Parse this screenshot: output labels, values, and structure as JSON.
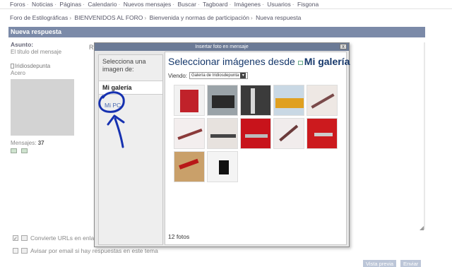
{
  "top_nav": [
    "Foros",
    "Noticias",
    "Páginas",
    "Calendario",
    "Nuevos mensajes",
    "Buscar",
    "Tagboard",
    "Imágenes",
    "Usuarios",
    "Fisgona"
  ],
  "breadcrumbs": [
    "Foro de Estilográficas",
    "BIENVENIDOS AL FORO",
    "Bienvenida y normas de participación",
    "Nueva respuesta"
  ],
  "section_title": "Nueva respuesta",
  "left": {
    "asunto_label": "Asunto:",
    "asunto_hint": "El título del mensaje",
    "username": "Iridiosdepunta",
    "rank": "Acero",
    "messages_label": "Mensajes:",
    "messages_count": "37"
  },
  "editor_partial_letter": "R",
  "options": {
    "convert_urls": "Convierte URLs en enlace",
    "email_notify": "Avisar por email si hay respuestas en este tema"
  },
  "buttons": {
    "preview": "Vista previa",
    "submit": "Enviar"
  },
  "modal": {
    "title": "Insertar foto en mensaje",
    "close": "x",
    "side_label": "Selecciona una imagen de:",
    "tab_gallery": "Mi galería",
    "tab_pc": "Mi PC",
    "heading_prefix": "Seleccionar imágenes desde",
    "heading_source": "Mi galería",
    "viewing_label": "Viendo:",
    "viewing_value": "Galería de Iridiosdepunta",
    "photo_count": "12 fotos",
    "thumbnails": [
      {
        "name": "thumb-red-notebook",
        "bg": "#f2f2f2",
        "fg": "#c0222a"
      },
      {
        "name": "thumb-camera",
        "bg": "#9aa3a8",
        "fg": "#2a2a2a"
      },
      {
        "name": "thumb-pen-clips",
        "bg": "#3b3b3b",
        "fg": "#d8d8d8"
      },
      {
        "name": "thumb-train",
        "bg": "#c9d8e4",
        "fg": "#e0a020"
      },
      {
        "name": "thumb-pen-script-1",
        "bg": "#eee8e4",
        "fg": "#7a4a4a"
      },
      {
        "name": "thumb-pen-script-2",
        "bg": "#f3eeee",
        "fg": "#8b3a3a"
      },
      {
        "name": "thumb-pen-on-paper",
        "bg": "#e7e2de",
        "fg": "#444444"
      },
      {
        "name": "thumb-red-clip-1",
        "bg": "#c8131b",
        "fg": "#bbbbbb"
      },
      {
        "name": "thumb-pen-script-3",
        "bg": "#f1ecec",
        "fg": "#6b3a3a"
      },
      {
        "name": "thumb-red-clip-2",
        "bg": "#cc1a1e",
        "fg": "#cccccc"
      },
      {
        "name": "thumb-pen-red-book",
        "bg": "#c9a06a",
        "fg": "#b81818"
      },
      {
        "name": "thumb-cat",
        "bg": "#f4f4f4",
        "fg": "#111111"
      }
    ]
  }
}
